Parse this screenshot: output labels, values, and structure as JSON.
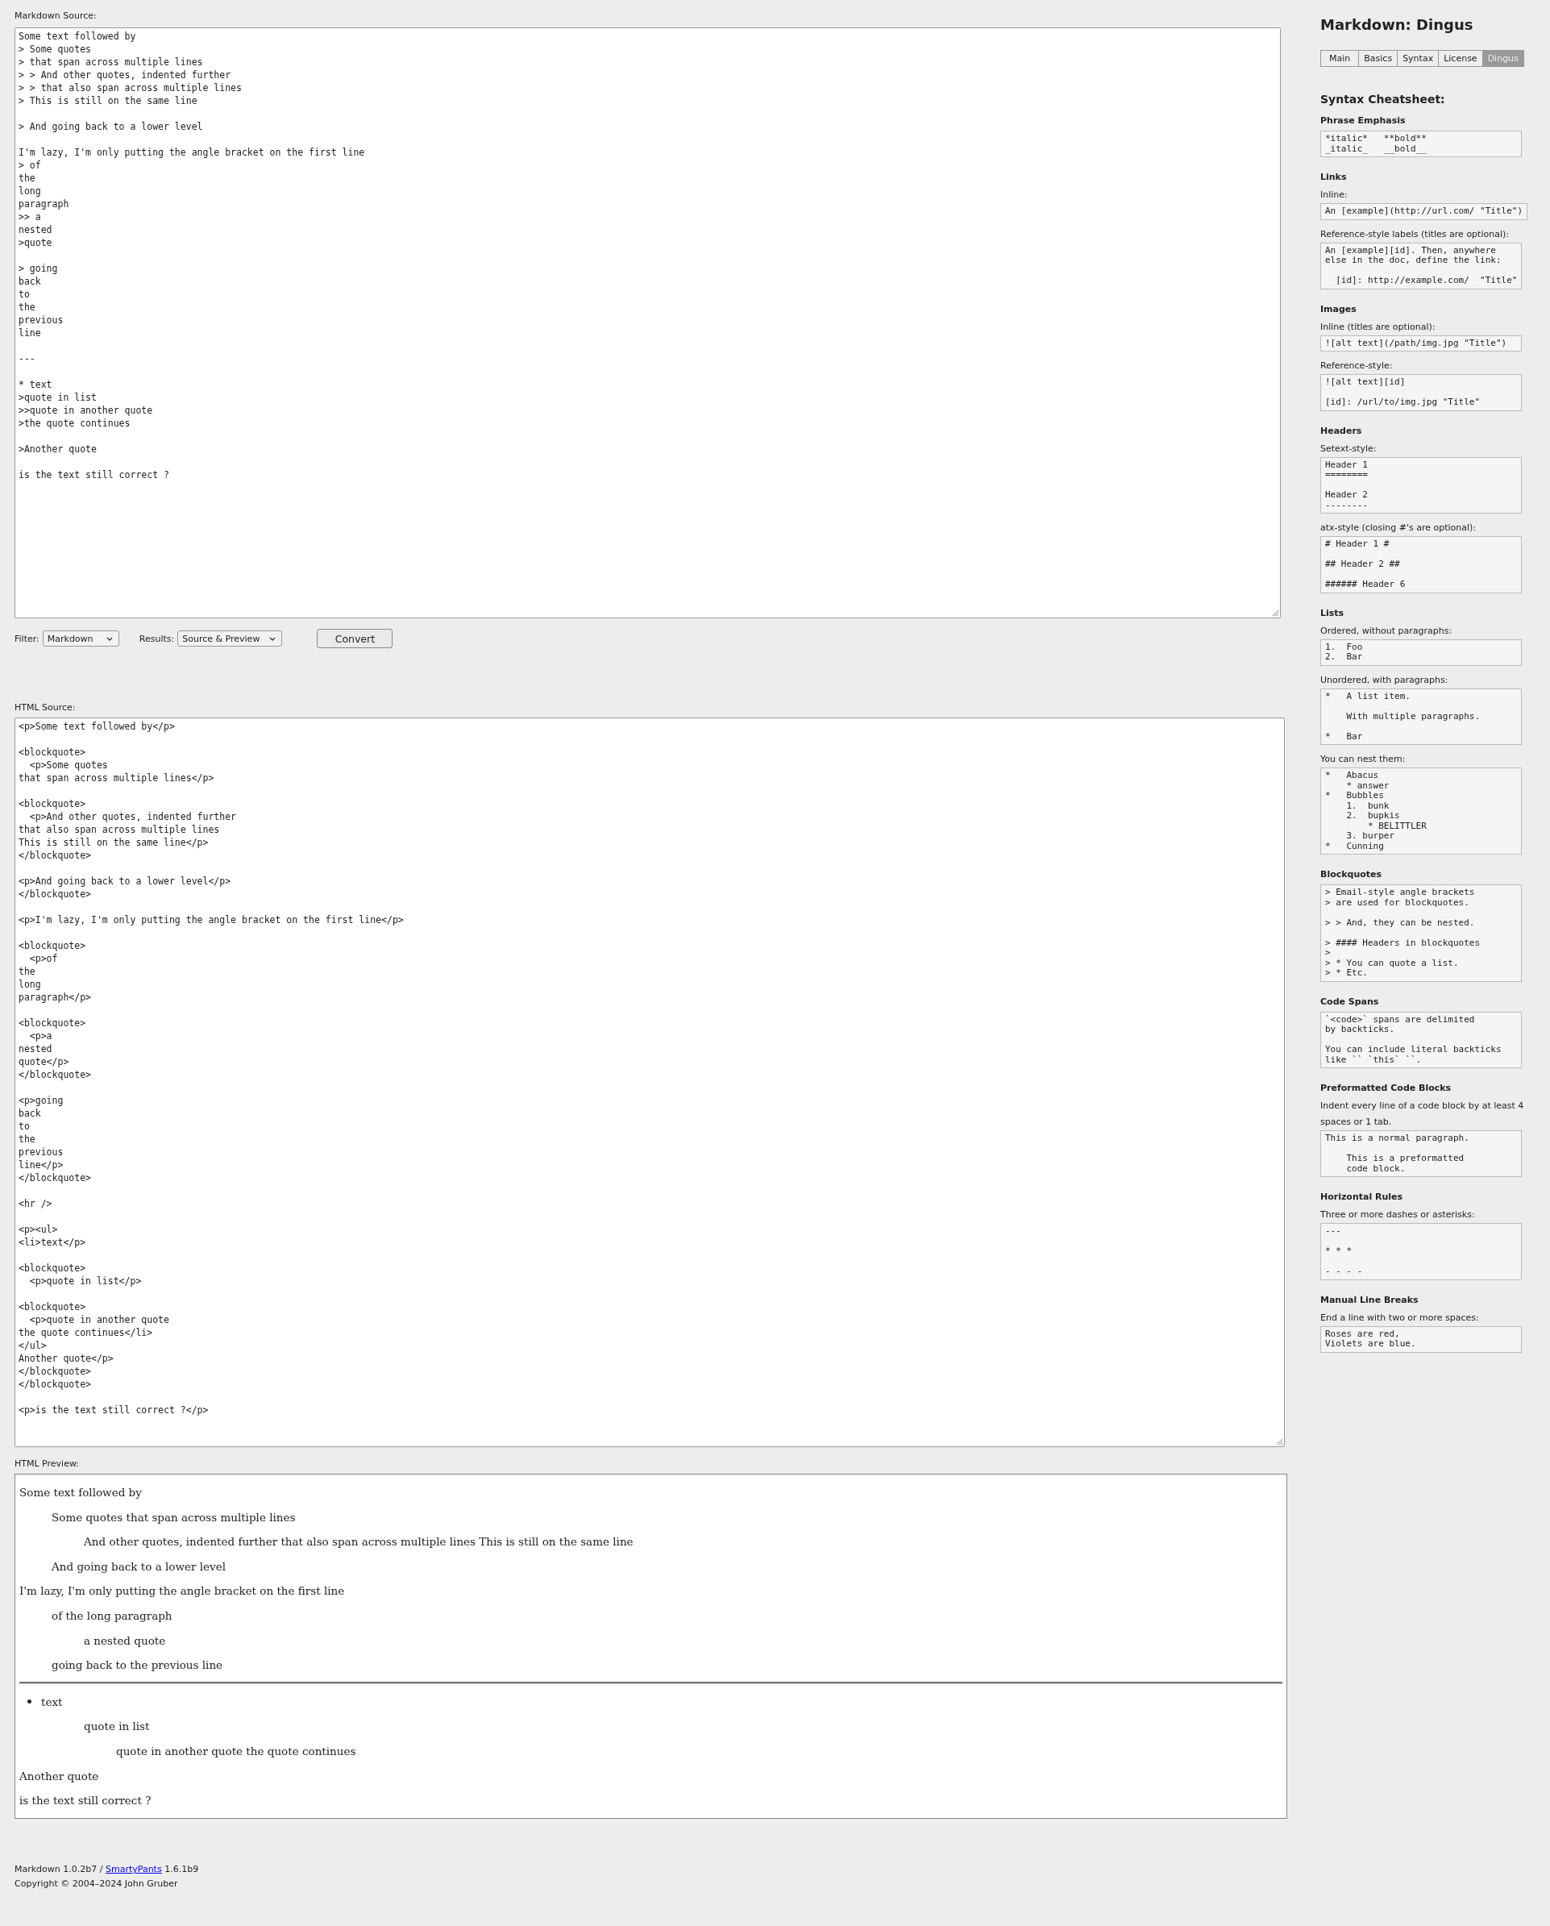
{
  "markdown_source": {
    "label": "Markdown Source:",
    "text": "Some text followed by\n> Some quotes\n> that span across multiple lines\n> > And other quotes, indented further\n> > that also span across multiple lines\n> This is still on the same line\n\n> And going back to a lower level\n\nI'm lazy, I'm only putting the angle bracket on the first line\n> of\nthe\nlong\nparagraph\n>> a\nnested\n>quote\n\n> going\nback\nto\nthe\nprevious\nline\n\n---\n\n* text\n>quote in list\n>>quote in another quote\n>the quote continues\n\n>Another quote\n\nis the text still correct ?"
  },
  "controls": {
    "filter_label": "Filter:",
    "filter_value": "Markdown",
    "results_label": "Results:",
    "results_value": "Source & Preview",
    "convert_button": "Convert"
  },
  "html_source": {
    "label": "HTML Source:",
    "text": "<p>Some text followed by</p>\n\n<blockquote>\n  <p>Some quotes\nthat span across multiple lines</p>\n\n<blockquote>\n  <p>And other quotes, indented further\nthat also span across multiple lines\nThis is still on the same line</p>\n</blockquote>\n\n<p>And going back to a lower level</p>\n</blockquote>\n\n<p>I'm lazy, I'm only putting the angle bracket on the first line</p>\n\n<blockquote>\n  <p>of\nthe\nlong\nparagraph</p>\n\n<blockquote>\n  <p>a\nnested\nquote</p>\n</blockquote>\n\n<p>going\nback\nto\nthe\nprevious\nline</p>\n</blockquote>\n\n<hr />\n\n<p><ul>\n<li>text</p>\n\n<blockquote>\n  <p>quote in list</p>\n\n<blockquote>\n  <p>quote in another quote\nthe quote continues</li>\n</ul>\nAnother quote</p>\n</blockquote>\n</blockquote>\n\n<p>is the text still correct ?</p>"
  },
  "html_preview": {
    "label": "HTML Preview:",
    "blocks": [
      {
        "kind": "p",
        "text": "Some text followed by"
      },
      {
        "kind": "quote",
        "children": [
          {
            "kind": "p",
            "text": "Some quotes that span across multiple lines"
          },
          {
            "kind": "quote",
            "children": [
              {
                "kind": "p",
                "text": "And other quotes, indented further that also span across multiple lines This is still on the same line"
              }
            ]
          },
          {
            "kind": "p",
            "text": "And going back to a lower level"
          }
        ]
      },
      {
        "kind": "p",
        "text": "I'm lazy, I'm only putting the angle bracket on the first line"
      },
      {
        "kind": "quote",
        "children": [
          {
            "kind": "p",
            "text": "of the long paragraph"
          },
          {
            "kind": "quote",
            "children": [
              {
                "kind": "p",
                "text": "a nested quote"
              }
            ]
          },
          {
            "kind": "p",
            "text": "going back to the previous line"
          }
        ]
      },
      {
        "kind": "hr"
      },
      {
        "kind": "li",
        "text": "text",
        "children": [
          {
            "kind": "quote",
            "children": [
              {
                "kind": "p",
                "text": "quote in list"
              },
              {
                "kind": "quote",
                "children": [
                  {
                    "kind": "p",
                    "text": "quote in another quote the quote continues"
                  }
                ]
              }
            ]
          }
        ]
      },
      {
        "kind": "p",
        "text": "Another quote"
      },
      {
        "kind": "p",
        "text": "is the text still correct ?"
      }
    ]
  },
  "footer": {
    "prefix": "Markdown 1.0.2b7 /",
    "link": "SmartyPants",
    "suffix": "1.6.1b9",
    "copyright": "Copyright © 2004–2024 John Gruber"
  },
  "sidebar": {
    "title": "Markdown: Dingus",
    "tabs": [
      {
        "label": "Main",
        "selected": false
      },
      {
        "label": "Basics",
        "selected": false
      },
      {
        "label": "Syntax",
        "selected": false
      },
      {
        "label": "License",
        "selected": false
      },
      {
        "label": "Dingus",
        "selected": true
      }
    ],
    "heading": "Syntax Cheatsheet:",
    "sections": [
      {
        "heading": "Phrase Emphasis",
        "blocks": [
          {
            "code": "*italic*   **bold**\n_italic_   __bold__"
          }
        ]
      },
      {
        "heading": "Links",
        "blocks": [
          {
            "label": "Inline:",
            "code": "An [example](http://url.com/ \"Title\")"
          },
          {
            "label": "Reference-style labels (titles are optional):",
            "code": "An [example][id]. Then, anywhere\nelse in the doc, define the link:\n\n  [id]: http://example.com/  \"Title\""
          }
        ]
      },
      {
        "heading": "Images",
        "blocks": [
          {
            "label": "Inline (titles are optional):",
            "code": "![alt text](/path/img.jpg \"Title\")"
          },
          {
            "label": "Reference-style:",
            "code": "![alt text][id]\n\n[id]: /url/to/img.jpg \"Title\""
          }
        ]
      },
      {
        "heading": "Headers",
        "blocks": [
          {
            "label": "Setext-style:",
            "code": "Header 1\n========\n\nHeader 2\n--------"
          },
          {
            "label": "atx-style (closing #'s are optional):",
            "code": "# Header 1 #\n\n## Header 2 ##\n\n###### Header 6"
          }
        ]
      },
      {
        "heading": "Lists",
        "blocks": [
          {
            "label": "Ordered, without paragraphs:",
            "code": "1.  Foo\n2.  Bar"
          },
          {
            "label": "Unordered, with paragraphs:",
            "code": "*   A list item.\n\n    With multiple paragraphs.\n\n*   Bar"
          },
          {
            "label": "You can nest them:",
            "code": "*   Abacus\n    * answer\n*   Bubbles\n    1.  bunk\n    2.  bupkis\n        * BELITTLER\n    3. burper\n*   Cunning"
          }
        ]
      },
      {
        "heading": "Blockquotes",
        "blocks": [
          {
            "code": "> Email-style angle brackets\n> are used for blockquotes.\n\n> > And, they can be nested.\n\n> #### Headers in blockquotes\n>\n> * You can quote a list.\n> * Etc."
          }
        ]
      },
      {
        "heading": "Code Spans",
        "blocks": [
          {
            "code": "`<code>` spans are delimited\nby backticks.\n\nYou can include literal backticks\nlike `` `this` ``."
          }
        ]
      },
      {
        "heading": "Preformatted Code Blocks",
        "blocks": [
          {
            "label": "Indent every line of a code block by at least 4 spaces or 1 tab.",
            "code": "This is a normal paragraph.\n\n    This is a preformatted\n    code block."
          }
        ]
      },
      {
        "heading": "Horizontal Rules",
        "blocks": [
          {
            "label": "Three or more dashes or asterisks:",
            "code": "---\n\n* * *\n\n- - - -"
          }
        ]
      },
      {
        "heading": "Manual Line Breaks",
        "blocks": [
          {
            "label": "End a line with two or more spaces:",
            "code": "Roses are red,\nViolets are blue."
          }
        ]
      }
    ]
  }
}
